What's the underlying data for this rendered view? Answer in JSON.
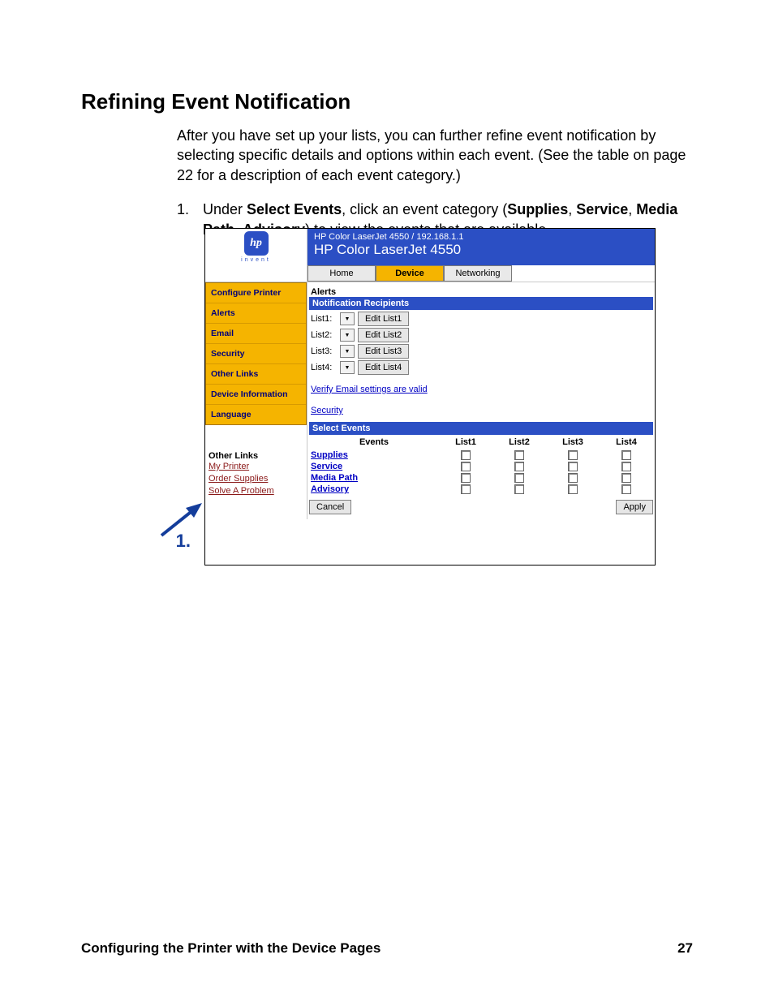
{
  "doc": {
    "title": "Refining Event Notification",
    "intro": "After you have set up your lists, you can further refine event notification by selecting specific details and options within each event. (See the table on page 22 for a description of each event category.)",
    "step_num": "1.",
    "step_prefix": "Under ",
    "step_b1": "Select Events",
    "step_mid1": ", click an event category (",
    "step_b2": "Supplies",
    "step_sep1": ", ",
    "step_b3": "Service",
    "step_sep2": ", ",
    "step_b4": "Media Path",
    "step_sep3": ", ",
    "step_b5": "Advisory",
    "step_suffix": ") to view the events that are available.",
    "callout_num": "1.",
    "footer_left": "Configuring the Printer with the Device Pages",
    "footer_right": "27"
  },
  "ui": {
    "logo_sub": "invent",
    "hdr_small": "HP Color LaserJet 4550 / 192.168.1.1",
    "hdr_big": "HP Color LaserJet 4550",
    "tabs": {
      "t0": "Home",
      "t1": "Device",
      "t2": "Networking"
    },
    "side": {
      "s0": "Configure Printer",
      "s1": "Alerts",
      "s2": "Email",
      "s3": "Security",
      "s4": "Other Links",
      "s5": "Device Information",
      "s6": "Language"
    },
    "other_hd": "Other Links",
    "other": {
      "o0": "My Printer",
      "o1": "Order Supplies",
      "o2": "Solve A Problem"
    },
    "alerts_hd": "Alerts",
    "recip_hd": "Notification Recipients",
    "recip": {
      "r0": {
        "label": "List1:",
        "btn": "Edit List1"
      },
      "r1": {
        "label": "List2:",
        "btn": "Edit List2"
      },
      "r2": {
        "label": "List3:",
        "btn": "Edit List3"
      },
      "r3": {
        "label": "List4:",
        "btn": "Edit List4"
      }
    },
    "verify_link": "Verify Email settings are valid",
    "security_link": "Security",
    "select_hd": "Select Events",
    "cols": {
      "c0": "Events",
      "c1": "List1",
      "c2": "List2",
      "c3": "List3",
      "c4": "List4"
    },
    "events": {
      "e0": "Supplies",
      "e1": "Service",
      "e2": "Media Path",
      "e3": "Advisory"
    },
    "btn_cancel": "Cancel",
    "btn_apply": "Apply"
  }
}
